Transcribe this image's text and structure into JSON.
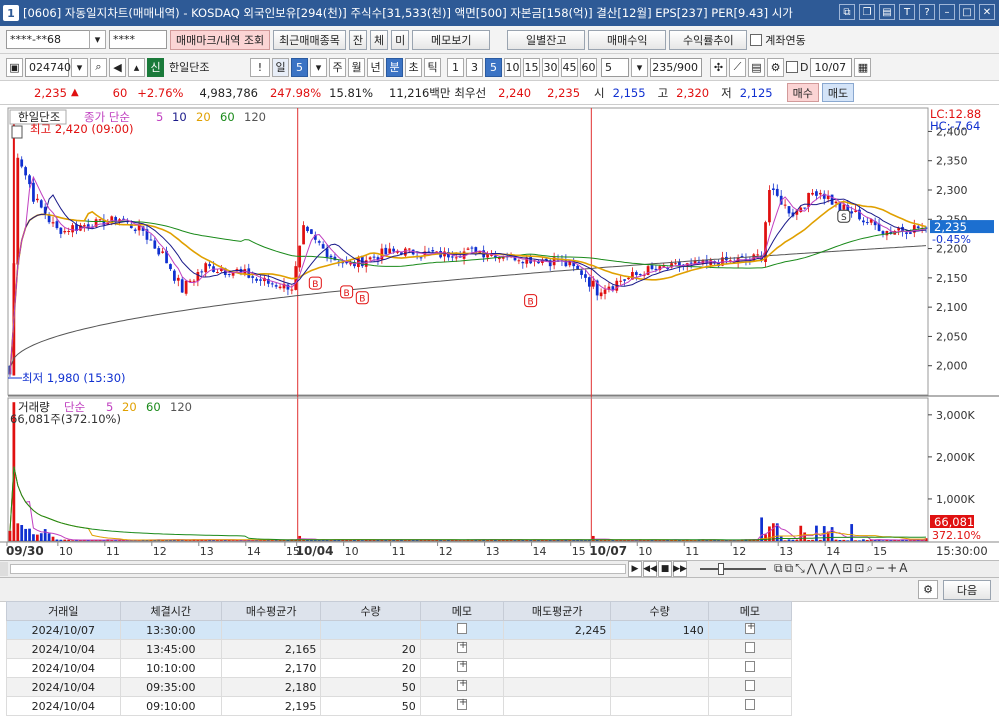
{
  "window": {
    "number": "1",
    "title": "[0606] 자동일지차트(매매내역) - KOSDAQ 외국인보유[294(천)] 주식수[31,533(천)] 액면[500] 자본금[158(억)] 결산[12월] EPS[237] PER[9.43] 시가"
  },
  "toolbar1": {
    "account": "****-**68",
    "password": "****",
    "trade_mark_btn": "매매마크/내역 조회",
    "recent_items_btn": "최근매매종목",
    "bal_btn": "잔",
    "exec_btn": "체",
    "unexec_btn": "미",
    "memo_btn": "메모보기",
    "daily_bal_btn": "일별잔고",
    "trade_profit_btn": "매매수익",
    "return_trend_btn": "수익률추이",
    "account_link_label": "계좌연동"
  },
  "toolbar2": {
    "code": "024740",
    "credit_badge": "신",
    "stock_name": "한일단조",
    "period_day": "일",
    "period_num": "5",
    "week": "주",
    "month": "월",
    "year": "년",
    "minute": "분",
    "second": "초",
    "tick": "틱",
    "intervals": [
      "1",
      "3",
      "5",
      "10",
      "15",
      "30",
      "45",
      "60"
    ],
    "selected_interval": "5",
    "count_select": "5",
    "count_value": "235/900",
    "date_label": "D",
    "date_value": "10/07"
  },
  "pricebar": {
    "price": "2,235",
    "arrow": "▲",
    "change": "60",
    "change_pct": "+2.76%",
    "volume": "4,983,786",
    "vol_ratio": "247.98%",
    "turnover": "15.81%",
    "amount": "11,216백만",
    "best_ask_label": "최우선",
    "best_ask": "2,240",
    "best_bid": "2,235",
    "open_label": "시",
    "open": "2,155",
    "high_label": "고",
    "high": "2,320",
    "low_label": "저",
    "low": "2,125",
    "buy_btn": "매수",
    "sell_btn": "매도"
  },
  "chart_data": [
    {
      "type": "line",
      "legend": [
        "한일단조",
        "종가 단순",
        "5",
        "10",
        "20",
        "60",
        "120"
      ],
      "legend_colors": [
        "#222222",
        "#c040c0",
        "#c040c0",
        "#1a1a8a",
        "#e0a000",
        "#1a8a1a",
        "#555555"
      ],
      "annotations": {
        "max": "최고 2,420 (09:00)",
        "min": "최저 1,980 (15:30)",
        "lc": "LC:12.88",
        "hc": "HC:-7.64",
        "last_price": "2,235",
        "last_pct": "-0.45%"
      },
      "y_ticks": [
        "2,400",
        "2,350",
        "2,300",
        "2,250",
        "2,200",
        "2,150",
        "2,100",
        "2,050",
        "2,000"
      ],
      "ylim": [
        1950,
        2440
      ],
      "x_labels": [
        "09/30",
        "10",
        "11",
        "12",
        "13",
        "14",
        "15",
        "10/04",
        "10",
        "11",
        "12",
        "13",
        "14",
        "15",
        "10/07",
        "10",
        "11",
        "12",
        "13",
        "14",
        "15"
      ],
      "session_starts": [
        "10/04",
        "10/07"
      ],
      "trade_marks": [
        {
          "label": "B",
          "x_index": 78,
          "price": 2165
        },
        {
          "label": "B",
          "x_index": 86,
          "price": 2150
        },
        {
          "label": "B",
          "x_index": 90,
          "price": 2140
        },
        {
          "label": "B",
          "x_index": 133,
          "price": 2135
        },
        {
          "label": "S",
          "x_index": 213,
          "price": 2245
        }
      ]
    },
    {
      "type": "bar",
      "legend": [
        "거래량",
        "단순",
        "5",
        "20",
        "60",
        "120"
      ],
      "legend_colors": [
        "#222222",
        "#c040c0",
        "#c040c0",
        "#e0a000",
        "#1a8a1a",
        "#555555"
      ],
      "annotation": "66,081주(372.10%)",
      "y_ticks": [
        "3,000K",
        "2,000K",
        "1,000K"
      ],
      "ylim": [
        0,
        3400000
      ],
      "last_value": "66,081",
      "last_pct": "372.10%"
    }
  ],
  "time_label": "15:30:00",
  "next_btn": "다음",
  "trade_table": {
    "headers": [
      "거래일",
      "체결시간",
      "매수평균가",
      "수량",
      "메모",
      "매도평균가",
      "수량",
      "메모"
    ],
    "rows": [
      {
        "date": "2024/10/07",
        "time": "13:30:00",
        "buy_avg": "",
        "buy_qty": "",
        "sell_avg": "2,245",
        "sell_qty": "140"
      },
      {
        "date": "2024/10/04",
        "time": "13:45:00",
        "buy_avg": "2,165",
        "buy_qty": "20",
        "sell_avg": "",
        "sell_qty": ""
      },
      {
        "date": "2024/10/04",
        "time": "10:10:00",
        "buy_avg": "2,170",
        "buy_qty": "20",
        "sell_avg": "",
        "sell_qty": ""
      },
      {
        "date": "2024/10/04",
        "time": "09:35:00",
        "buy_avg": "2,180",
        "buy_qty": "50",
        "sell_avg": "",
        "sell_qty": ""
      },
      {
        "date": "2024/10/04",
        "time": "09:10:00",
        "buy_avg": "2,195",
        "buy_qty": "50",
        "sell_avg": "",
        "sell_qty": ""
      }
    ]
  }
}
